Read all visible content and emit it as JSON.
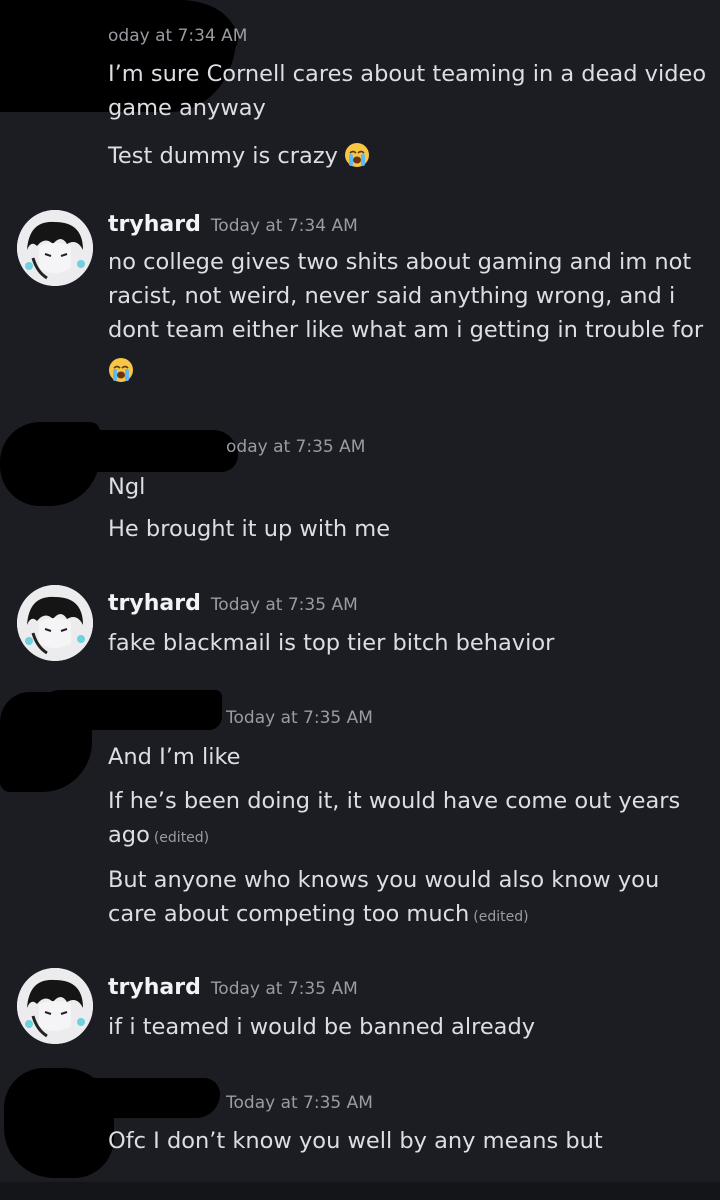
{
  "messages": [
    {
      "timestamp": "oday at 7:34 AM",
      "lines": [
        "I’m sure Cornell cares about teaming in a dead video game anyway",
        "Test dummy is crazy"
      ]
    },
    {
      "username": "tryhard",
      "timestamp": "Today at 7:34 AM",
      "lines": [
        "no college gives two shits about gaming and im not racist, not weird, never said anything wrong, and i dont team either like what am i getting in trouble for"
      ]
    },
    {
      "timestamp": "oday at 7:35 AM",
      "lines": [
        "Ngl",
        "He brought it up with me"
      ]
    },
    {
      "username": "tryhard",
      "timestamp": "Today at 7:35 AM",
      "lines": [
        "fake blackmail is top tier bitch behavior"
      ]
    },
    {
      "timestamp": "Today at 7:35 AM",
      "lines": [
        "And I’m like",
        "If he’s been doing it, it would have come out years ago",
        "But anyone who knows you would also know you care about competing too much"
      ],
      "edited_label": "(edited)"
    },
    {
      "username": "tryhard",
      "timestamp": "Today at 7:35 AM",
      "lines": [
        "if i teamed i would be banned already"
      ]
    },
    {
      "timestamp": "Today at 7:35 AM",
      "lines": [
        "Ofc I don’t know you well by any means but"
      ]
    }
  ],
  "icons": {
    "emoji": "loudly-crying-face-icon",
    "avatar": "anime-avatar-icon"
  },
  "colors": {
    "background": "#1c1d22",
    "username": "#f2f3f5",
    "text": "#dcdee3",
    "muted": "#9a9ca3"
  }
}
